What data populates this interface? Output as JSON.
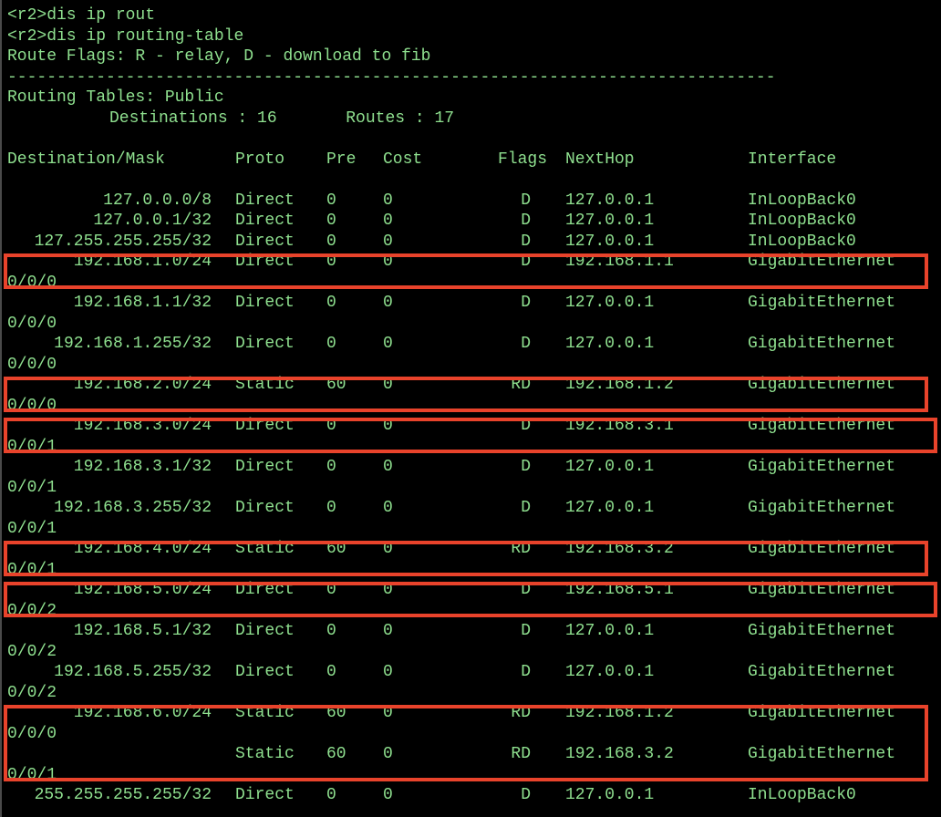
{
  "colors": {
    "background": "#000000",
    "text": "#8fe08f",
    "highlight": "#e8432b"
  },
  "commands": [
    "<r2>dis ip rout",
    "<r2>dis ip routing-table",
    "Route Flags: R - relay, D - download to fib"
  ],
  "separator": "------------------------------------------------------------------------------",
  "table_title": "Routing Tables: Public",
  "summary": "Destinations : 16       Routes : 17",
  "headers": {
    "dest": "Destination/Mask",
    "proto": "Proto",
    "pre": "Pre",
    "cost": "Cost",
    "flags": "Flags",
    "nexthop": "NextHop",
    "iface": "Interface"
  },
  "routes": [
    {
      "dest": "127.0.0.0/8",
      "proto": "Direct",
      "pre": "0",
      "cost": "0",
      "flags": "D",
      "nexthop": "127.0.0.1",
      "iface": "InLoopBack0",
      "wrap": "",
      "highlighted": false
    },
    {
      "dest": "127.0.0.1/32",
      "proto": "Direct",
      "pre": "0",
      "cost": "0",
      "flags": "D",
      "nexthop": "127.0.0.1",
      "iface": "InLoopBack0",
      "wrap": "",
      "highlighted": false
    },
    {
      "dest": "127.255.255.255/32",
      "proto": "Direct",
      "pre": "0",
      "cost": "0",
      "flags": "D",
      "nexthop": "127.0.0.1",
      "iface": "InLoopBack0",
      "wrap": "",
      "highlighted": false
    },
    {
      "dest": "192.168.1.0/24",
      "proto": "Direct",
      "pre": "0",
      "cost": "0",
      "flags": "D",
      "nexthop": "192.168.1.1",
      "iface": "GigabitEthernet",
      "wrap": "0/0/0",
      "highlighted": true
    },
    {
      "dest": "192.168.1.1/32",
      "proto": "Direct",
      "pre": "0",
      "cost": "0",
      "flags": "D",
      "nexthop": "127.0.0.1",
      "iface": "GigabitEthernet",
      "wrap": "0/0/0",
      "highlighted": false
    },
    {
      "dest": "192.168.1.255/32",
      "proto": "Direct",
      "pre": "0",
      "cost": "0",
      "flags": "D",
      "nexthop": "127.0.0.1",
      "iface": "GigabitEthernet",
      "wrap": "0/0/0",
      "highlighted": false
    },
    {
      "dest": "192.168.2.0/24",
      "proto": "Static",
      "pre": "60",
      "cost": "0",
      "flags": "RD",
      "nexthop": "192.168.1.2",
      "iface": "GigabitEthernet",
      "wrap": "0/0/0",
      "highlighted": true
    },
    {
      "dest": "192.168.3.0/24",
      "proto": "Direct",
      "pre": "0",
      "cost": "0",
      "flags": "D",
      "nexthop": "192.168.3.1",
      "iface": "GigabitEthernet",
      "wrap": "0/0/1",
      "highlighted": true
    },
    {
      "dest": "192.168.3.1/32",
      "proto": "Direct",
      "pre": "0",
      "cost": "0",
      "flags": "D",
      "nexthop": "127.0.0.1",
      "iface": "GigabitEthernet",
      "wrap": "0/0/1",
      "highlighted": false
    },
    {
      "dest": "192.168.3.255/32",
      "proto": "Direct",
      "pre": "0",
      "cost": "0",
      "flags": "D",
      "nexthop": "127.0.0.1",
      "iface": "GigabitEthernet",
      "wrap": "0/0/1",
      "highlighted": false
    },
    {
      "dest": "192.168.4.0/24",
      "proto": "Static",
      "pre": "60",
      "cost": "0",
      "flags": "RD",
      "nexthop": "192.168.3.2",
      "iface": "GigabitEthernet",
      "wrap": "0/0/1",
      "highlighted": true
    },
    {
      "dest": "192.168.5.0/24",
      "proto": "Direct",
      "pre": "0",
      "cost": "0",
      "flags": "D",
      "nexthop": "192.168.5.1",
      "iface": "GigabitEthernet",
      "wrap": "0/0/2",
      "highlighted": true
    },
    {
      "dest": "192.168.5.1/32",
      "proto": "Direct",
      "pre": "0",
      "cost": "0",
      "flags": "D",
      "nexthop": "127.0.0.1",
      "iface": "GigabitEthernet",
      "wrap": "0/0/2",
      "highlighted": false
    },
    {
      "dest": "192.168.5.255/32",
      "proto": "Direct",
      "pre": "0",
      "cost": "0",
      "flags": "D",
      "nexthop": "127.0.0.1",
      "iface": "GigabitEthernet",
      "wrap": "0/0/2",
      "highlighted": false
    },
    {
      "dest": "192.168.6.0/24",
      "proto": "Static",
      "pre": "60",
      "cost": "0",
      "flags": "RD",
      "nexthop": "192.168.1.2",
      "iface": "GigabitEthernet",
      "wrap": "0/0/0",
      "highlighted": true
    },
    {
      "dest": "",
      "proto": "Static",
      "pre": "60",
      "cost": "0",
      "flags": "RD",
      "nexthop": "192.168.3.2",
      "iface": "GigabitEthernet",
      "wrap": "0/0/1",
      "highlighted": true
    },
    {
      "dest": "255.255.255.255/32",
      "proto": "Direct",
      "pre": "0",
      "cost": "0",
      "flags": "D",
      "nexthop": "127.0.0.1",
      "iface": "InLoopBack0",
      "wrap": "",
      "highlighted": false
    }
  ]
}
